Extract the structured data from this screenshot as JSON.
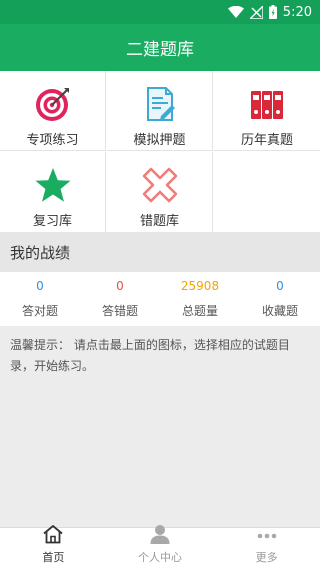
{
  "status_bar": {
    "time": "5:20"
  },
  "header": {
    "title": "二建题库"
  },
  "grid": [
    {
      "label": "专项练习",
      "icon": "target-icon"
    },
    {
      "label": "模拟押题",
      "icon": "document-edit-icon"
    },
    {
      "label": "历年真题",
      "icon": "binders-icon"
    },
    {
      "label": "复习库",
      "icon": "star-icon"
    },
    {
      "label": "错题库",
      "icon": "cross-icon"
    }
  ],
  "record": {
    "title": "我的战绩",
    "stats": [
      {
        "value": "0",
        "label": "答对题",
        "color": "#3a8fd8"
      },
      {
        "value": "0",
        "label": "答错题",
        "color": "#e5534b"
      },
      {
        "value": "25908",
        "label": "总题量",
        "color": "#f0a500"
      },
      {
        "value": "0",
        "label": "收藏题",
        "color": "#3a8fd8"
      }
    ]
  },
  "tip": {
    "text": "温馨提示： 请点击最上面的图标，选择相应的试题目录，开始练习。"
  },
  "bottom_nav": [
    {
      "label": "首页",
      "icon": "home-icon",
      "active": true
    },
    {
      "label": "个人中心",
      "icon": "person-icon",
      "active": false
    },
    {
      "label": "更多",
      "icon": "more-icon",
      "active": false
    }
  ],
  "colors": {
    "primary": "#1aad62",
    "status_bar": "#15a05a"
  }
}
